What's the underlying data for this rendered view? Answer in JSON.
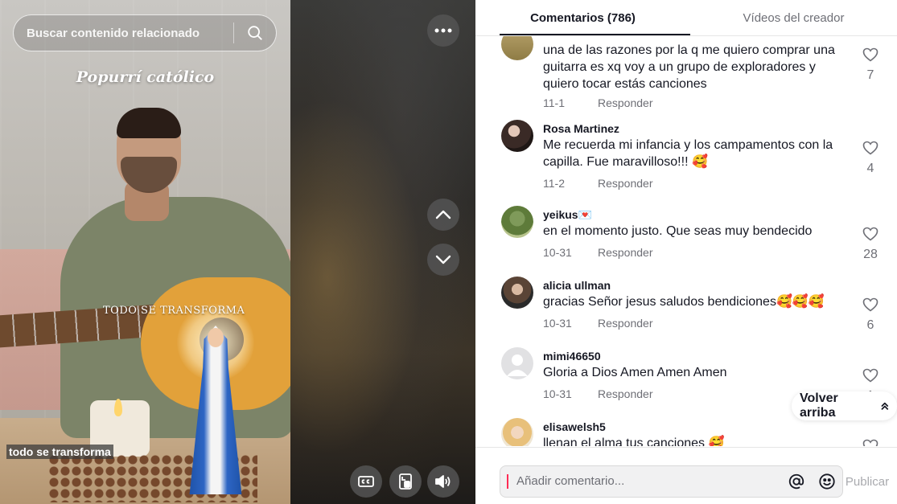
{
  "search": {
    "placeholder": "Buscar contenido relacionado",
    "icon": "search-icon"
  },
  "video": {
    "title_overlay": "Popurrí católico",
    "shirt_overlay": "TODO SE TRANSFORMA",
    "caption": "todo se transforma"
  },
  "controls": {
    "more_icon": "more-icon",
    "up_icon": "chevron-up-icon",
    "down_icon": "chevron-down-icon",
    "cc_icon": "closed-captions-icon",
    "mini_player_icon": "mini-player-icon",
    "volume_icon": "volume-icon"
  },
  "tabs": {
    "comments": "Comentarios (786)",
    "creator_videos": "Vídeos del creador"
  },
  "comments": [
    {
      "user": "",
      "text": "una de las razones por la q me quiero comprar una guitarra es xq voy a un grupo de exploradores y quiero tocar estás canciones",
      "date": "11-1",
      "reply": "Responder",
      "likes": "7"
    },
    {
      "user": "Rosa Martinez",
      "text": "Me recuerda mi infancia y los campamentos con la capilla. Fue maravilloso!!! 🥰",
      "date": "11-2",
      "reply": "Responder",
      "likes": "4"
    },
    {
      "user": "yeikus💌",
      "text": "en el momento justo. Que seas muy bendecido",
      "date": "10-31",
      "reply": "Responder",
      "likes": "28"
    },
    {
      "user": "alicia ullman",
      "text": "gracias Señor jesus saludos bendiciones🥰🥰🥰",
      "date": "10-31",
      "reply": "Responder",
      "likes": "6"
    },
    {
      "user": "mimi46650",
      "text": "Gloria a Dios Amen Amen Amen",
      "date": "10-31",
      "reply": "Responder",
      "likes": "1"
    },
    {
      "user": "elisawelsh5",
      "text": "llenan el alma tus canciones 🥰",
      "date": "",
      "reply": "",
      "likes": ""
    }
  ],
  "back_to_top": "Volver arriba",
  "comment_input": {
    "placeholder": "Añadir comentario...",
    "mention_icon": "at-icon",
    "emoji_icon": "emoji-icon",
    "publish": "Publicar"
  },
  "colors": {
    "accent": "#fe2c55",
    "text": "#161823",
    "muted": "#6e6f76"
  }
}
